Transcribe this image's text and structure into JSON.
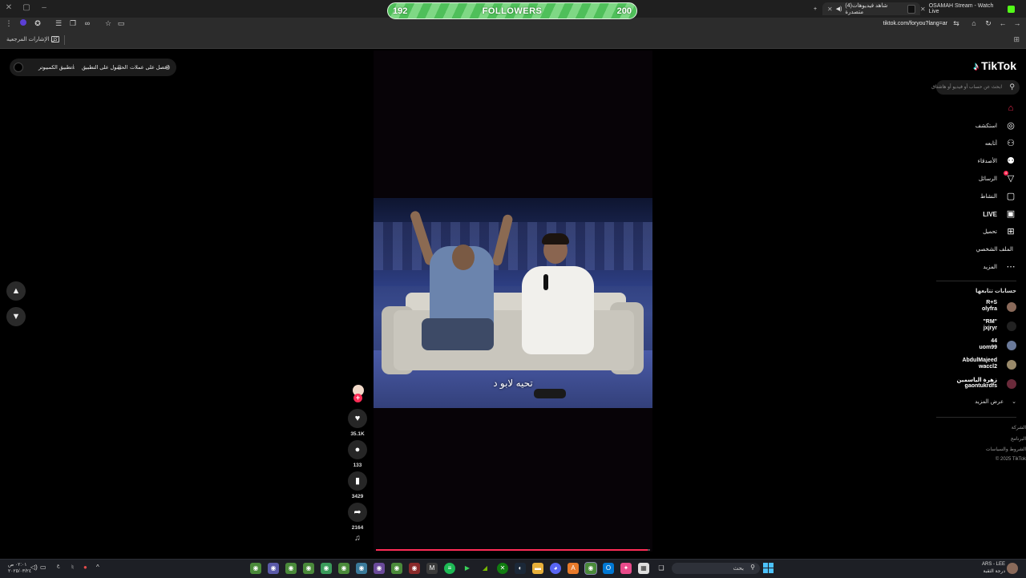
{
  "browser": {
    "tabs": [
      {
        "label": "OSAMAH Stream - Watch Live",
        "active": false
      },
      {
        "label": "(4)شاهد فيديوهات متصدرة",
        "active": true
      }
    ],
    "url": "tiktok.com/foryou?lang=ar",
    "bookmarks_all": "كل الإشارات المرجعية"
  },
  "followers_bar": {
    "current": "192",
    "label": "FOLLOWERS",
    "goal": "200",
    "progress": 0.96
  },
  "top_pill": {
    "coins": "احصل على عملات",
    "get_app": "الحصول على التطبيق",
    "desktop_app": "تطبيق الكمبيوتر"
  },
  "tiktok": {
    "logo": "TikTok",
    "search_placeholder": "ابحث عن حساب أو فيديو أو هاشتاق",
    "nav": [
      {
        "label": "",
        "icon": "home-icon"
      },
      {
        "label": "استكشف",
        "icon": "compass-icon"
      },
      {
        "label": "أتابعه",
        "icon": "following-icon"
      },
      {
        "label": "الأصدقاء",
        "icon": "friends-icon"
      },
      {
        "label": "الرسائل",
        "icon": "messages-icon",
        "badge": "4"
      },
      {
        "label": "النشاط",
        "icon": "activity-icon"
      },
      {
        "label": "LIVE",
        "icon": "live-icon"
      },
      {
        "label": "تحميل",
        "icon": "upload-icon"
      },
      {
        "label": "الملف الشخصي",
        "icon": "profile-icon"
      },
      {
        "label": "المزيد",
        "icon": "more-icon"
      }
    ],
    "following_title": "حسابات تتابعها",
    "following": [
      {
        "name": "R+S",
        "handle": "olyfra",
        "color": "#8a6a5a"
      },
      {
        "name": "\"RM\"",
        "handle": "jxjryr",
        "color": "#222222"
      },
      {
        "name": "44",
        "handle": "uom99",
        "color": "#6a7a9a"
      },
      {
        "name": "AbdulMajeed",
        "handle": "waccl2",
        "color": "#9a8a6a"
      },
      {
        "name": "زهرة الياسمين",
        "handle": "gaontukrdfs",
        "color": "#6a2a3a"
      }
    ],
    "show_more": "عرض المزيد",
    "footer": [
      "الشركة",
      "البرنامج",
      "الشروط والسياسات",
      "© 2025 TikTok"
    ]
  },
  "video": {
    "caption": "تحيه لابو د",
    "progress": 0.99,
    "likes": "35.1K",
    "comments": "133",
    "saves": "3429",
    "shares": "2164"
  },
  "taskbar": {
    "search": "بحث",
    "lang": "ARS - LEE",
    "lang_sub": "درجة الثقبة",
    "time": "٠٢:٠١ ص",
    "date": "٢٠٢٥/٠٣/٢٤",
    "weather": "ع"
  }
}
